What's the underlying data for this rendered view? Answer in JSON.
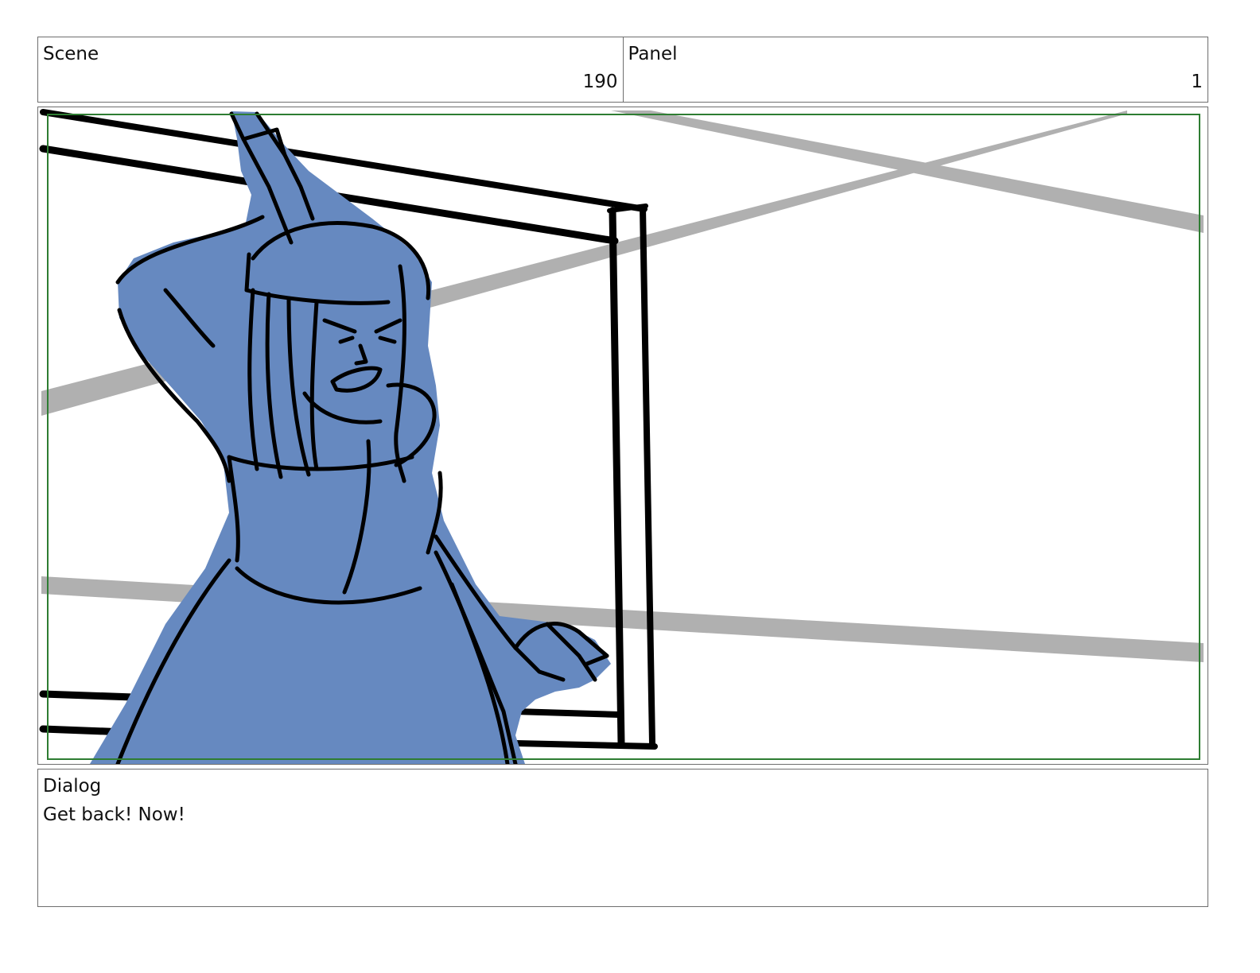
{
  "header": {
    "scene_label": "Scene",
    "scene_value": "190",
    "panel_label": "Panel",
    "panel_value": "1"
  },
  "panel_image": {
    "safe_area_color": "#2e7d32",
    "figure_fill": "#6689c0",
    "background_lines": "#b0b0b0"
  },
  "dialog": {
    "label": "Dialog",
    "text": "Get back! Now!"
  }
}
